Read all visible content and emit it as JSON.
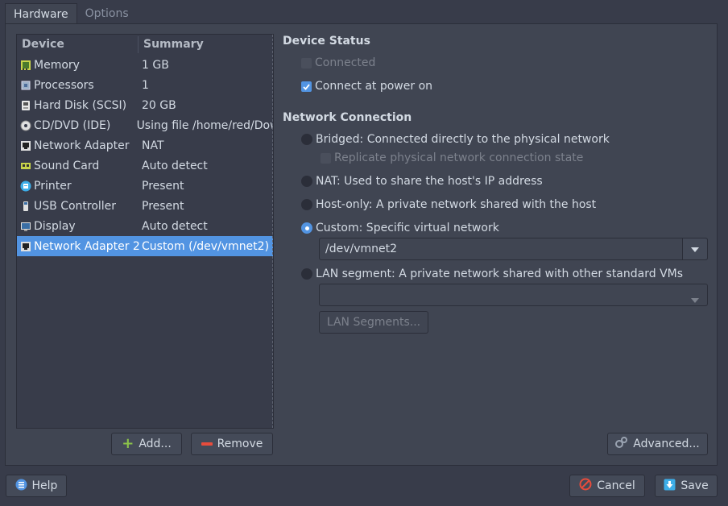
{
  "tabs": [
    {
      "label": "Hardware",
      "active": true
    },
    {
      "label": "Options",
      "active": false
    }
  ],
  "device_list": {
    "headers": {
      "device": "Device",
      "summary": "Summary"
    },
    "rows": [
      {
        "device": "Memory",
        "summary": "1 GB",
        "icon": "memory-icon"
      },
      {
        "device": "Processors",
        "summary": "1",
        "icon": "processor-icon"
      },
      {
        "device": "Hard Disk (SCSI)",
        "summary": "20 GB",
        "icon": "hard-disk-icon"
      },
      {
        "device": "CD/DVD (IDE)",
        "summary": "Using file /home/red/Dow",
        "icon": "cd-dvd-icon"
      },
      {
        "device": "Network Adapter",
        "summary": "NAT",
        "icon": "network-adapter-icon"
      },
      {
        "device": "Sound Card",
        "summary": "Auto detect",
        "icon": "sound-card-icon"
      },
      {
        "device": "Printer",
        "summary": "Present",
        "icon": "printer-icon"
      },
      {
        "device": "USB Controller",
        "summary": "Present",
        "icon": "usb-icon"
      },
      {
        "device": "Display",
        "summary": "Auto detect",
        "icon": "display-icon"
      },
      {
        "device": "Network Adapter 2",
        "summary": "Custom (/dev/vmnet2)",
        "icon": "network-adapter-icon",
        "selected": true
      }
    ]
  },
  "list_buttons": {
    "add": "Add...",
    "remove": "Remove"
  },
  "device_status": {
    "title": "Device Status",
    "connected": {
      "label": "Connected",
      "checked": false,
      "disabled": true
    },
    "connect_at_power_on": {
      "label": "Connect at power on",
      "checked": true
    }
  },
  "network_connection": {
    "title": "Network Connection",
    "bridged": "Bridged: Connected directly to the physical network",
    "replicate": "Replicate physical network connection state",
    "nat": "NAT: Used to share the host's IP address",
    "host_only": "Host-only: A private network shared with the host",
    "custom": "Custom: Specific virtual network",
    "custom_value": "/dev/vmnet2",
    "lan_segment": "LAN segment: A private network shared with other standard VMs",
    "lan_segment_value": "",
    "lan_segments_button": "LAN Segments...",
    "selected": "custom"
  },
  "advanced_button": "Advanced...",
  "footer": {
    "help": "Help",
    "cancel": "Cancel",
    "save": "Save"
  },
  "colors": {
    "background": "#383c4a",
    "panel": "#404552",
    "accent": "#5294e2",
    "add": "#8bc34a",
    "remove": "#e74c3c"
  }
}
